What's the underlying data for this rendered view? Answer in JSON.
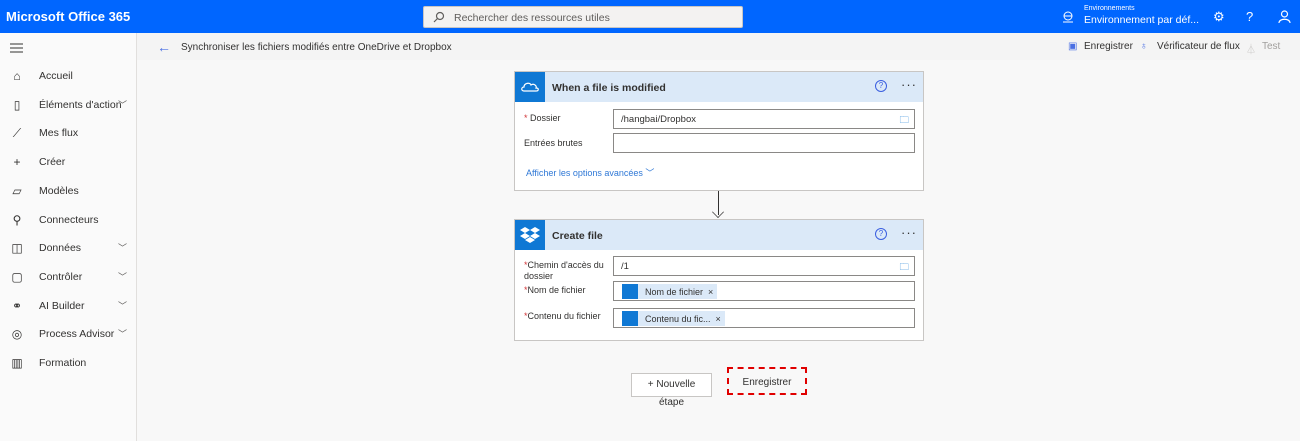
{
  "header": {
    "brand": "Microsoft Office 365",
    "search_placeholder": "Rechercher des ressources utiles",
    "env_label": "Environnements",
    "env_value": "Environnement par déf...",
    "settings_icon": "⚙",
    "help_icon": "?"
  },
  "sidebar": {
    "items": [
      {
        "label": "Accueil",
        "icon": "⌂",
        "chevron": false
      },
      {
        "label": "Éléments d'action",
        "icon": "▯",
        "chevron": true
      },
      {
        "label": "Mes flux",
        "icon": "⟋",
        "chevron": false
      },
      {
        "label": "Créer",
        "icon": "+",
        "chevron": false
      },
      {
        "label": "Modèles",
        "icon": "▱",
        "chevron": false
      },
      {
        "label": "Connecteurs",
        "icon": "⚲",
        "chevron": false
      },
      {
        "label": "Données",
        "icon": "◫",
        "chevron": true
      },
      {
        "label": "Contrôler",
        "icon": "▢",
        "chevron": true
      },
      {
        "label": "AI Builder",
        "icon": "⚭",
        "chevron": true
      },
      {
        "label": "Process Advisor",
        "icon": "◎",
        "chevron": true
      },
      {
        "label": "Formation",
        "icon": "▥",
        "chevron": false
      }
    ]
  },
  "subheader": {
    "title": "Synchroniser les fichiers modifiés entre OneDrive et Dropbox",
    "save": "Enregistrer",
    "checker": "Vérificateur de flux",
    "test": "Test"
  },
  "trigger": {
    "title": "When a file is modified",
    "folder_label": "Dossier",
    "folder_value": "/hangbai/Dropbox",
    "raw_label": "Entrées brutes",
    "raw_value": "",
    "advanced": "Afficher les options avancées"
  },
  "action": {
    "title": "Create file",
    "path_label": "Chemin d'accès du dossier",
    "path_value": "/1",
    "name_label": "Nom de fichier",
    "name_token": "Nom de fichier",
    "content_label": "Contenu du fichier",
    "content_token": "Contenu du fic...",
    "remove": "×"
  },
  "footer": {
    "new_step_1": "+ Nouvelle",
    "new_step_2": "étape",
    "save": "Enregistrer"
  },
  "colors": {
    "brand": "#0066ff",
    "connector": "#0f78d4",
    "highlight": "#e00000"
  }
}
